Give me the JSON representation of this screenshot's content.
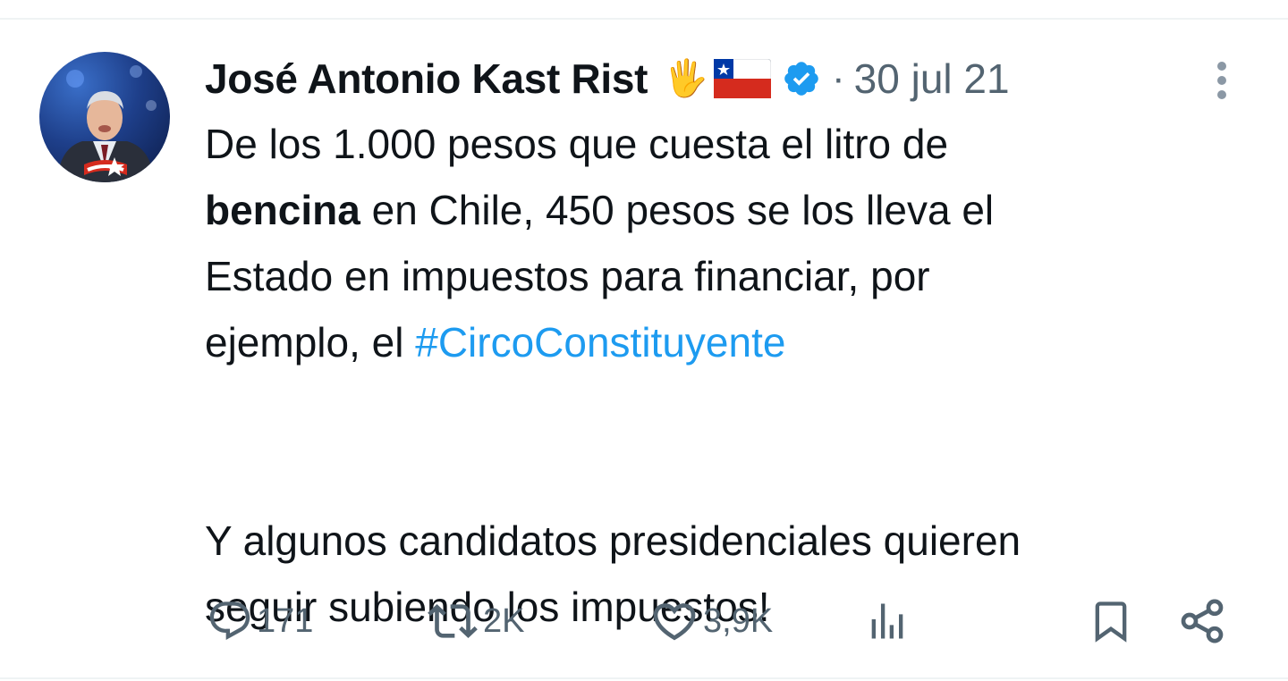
{
  "tweet": {
    "author": {
      "name": "José Antonio Kast Rist",
      "emoji": "🖐",
      "flag_icon": "chile-flag-icon",
      "verified_icon": "verified-badge-icon"
    },
    "separator": "·",
    "date": "30 jul 21",
    "text": {
      "p1_before_bold": "De los 1.000 pesos que cuesta el litro de\n",
      "p1_bold": "bencina",
      "p1_after_bold": " en Chile, 450 pesos se los lleva el\nEstado en impuestos para financiar, por\nejemplo, el ",
      "hashtag": "#CircoConstituyente",
      "p2": "\n\n\nY algunos candidatos presidenciales quieren\nseguir subiendo los impuestos!"
    },
    "actions": {
      "replies": "171",
      "retweets": "2K",
      "likes": "3,9K"
    }
  },
  "colors": {
    "text": "#0f1419",
    "secondary": "#536471",
    "link": "#1d9bf0",
    "verified": "#1d9bf0",
    "divider": "#eff3f4"
  }
}
